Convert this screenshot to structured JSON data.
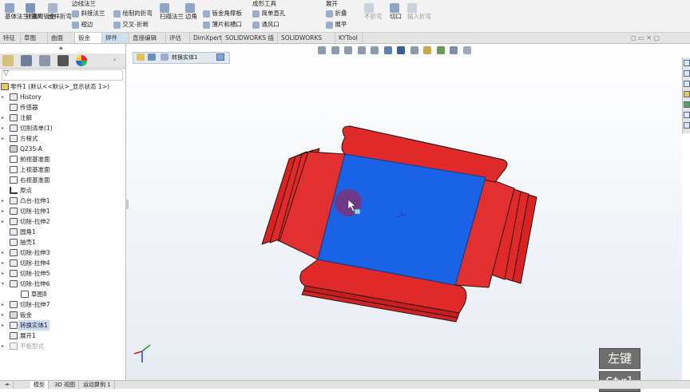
{
  "ribbon": {
    "items": [
      "基体法兰/薄片",
      "转换到钣金",
      "放样折弯",
      "边线法兰",
      "斜接法兰",
      "褶边",
      "绘制的折弯",
      "交叉-折断",
      "扫描法兰",
      "边角",
      "钣金角撑板",
      "薄片和槽口",
      "成形工具",
      "简单直孔",
      "通风口",
      "展开",
      "折叠",
      "不折弯",
      "插入折弯",
      "展平",
      "切口"
    ]
  },
  "tabs": [
    "特征",
    "草图",
    "曲面",
    "钣金",
    "焊件",
    "直接编辑",
    "评估",
    "DimXpert",
    "SOLIDWORKS 插件",
    "SOLIDWORKS MBD",
    "KYTool"
  ],
  "tree": {
    "root": "零件1 (默认<<默认>_显示状态 1>)",
    "items": [
      "History",
      "传感器",
      "注解",
      "切割清单(1)",
      "方程式",
      "Q235-A",
      "前视基准面",
      "上视基准面",
      "右视基准面",
      "原点",
      "凸台-拉伸1",
      "切除-拉伸1",
      "切除-拉伸2",
      "圆角1",
      "抽壳1",
      "切除-拉伸3",
      "切除-拉伸4",
      "切除-拉伸5",
      "切除-拉伸6",
      "草图8",
      "切除-拉伸7",
      "钣金",
      "转换实体1",
      "展开1",
      "平板型式"
    ]
  },
  "viewport": {
    "breadcrumb": "转换实体1"
  },
  "bottom_tabs": [
    "模型",
    "3D 视图",
    "运动算例 1"
  ],
  "keys": [
    "左键",
    "Ctrl"
  ],
  "colors": {
    "red": "#e02a2a",
    "blue": "#1a63e6",
    "selection": "#c9dcf3"
  }
}
